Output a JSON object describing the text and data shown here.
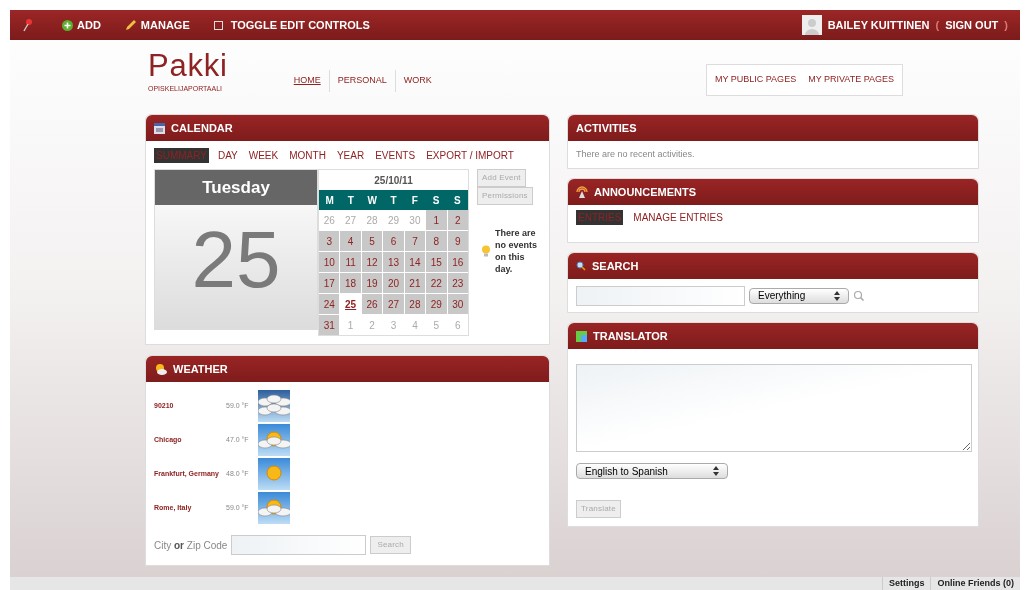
{
  "topbar": {
    "items": [
      {
        "label": "ADD"
      },
      {
        "label": "MANAGE"
      },
      {
        "label": "TOGGLE EDIT CONTROLS",
        "checked": false
      }
    ],
    "user": "BAILEY KUITTINEN",
    "paren_open": "(",
    "sign_out": "SIGN OUT",
    "paren_close": ")"
  },
  "site": {
    "logo": "Pakki",
    "tagline": "OPISKELIJAPORTAALI",
    "nav": [
      {
        "label": "HOME",
        "selected": true
      },
      {
        "label": "PERSONAL",
        "selected": false
      },
      {
        "label": "WORK",
        "selected": false
      }
    ],
    "page_links": [
      "MY PUBLIC PAGES",
      "MY PRIVATE PAGES"
    ]
  },
  "calendar": {
    "title": "CALENDAR",
    "tabs": [
      {
        "label": "SUMMARY",
        "selected": true
      },
      {
        "label": "DAY",
        "selected": false
      },
      {
        "label": "WEEK",
        "selected": false
      },
      {
        "label": "MONTH",
        "selected": false
      },
      {
        "label": "YEAR",
        "selected": false
      },
      {
        "label": "EVENTS",
        "selected": false
      },
      {
        "label": "EXPORT / IMPORT",
        "selected": false
      }
    ],
    "weekday": "Tuesday",
    "day": "25",
    "month_label": "25/10/11",
    "headers": [
      "M",
      "T",
      "W",
      "T",
      "F",
      "S",
      "S"
    ],
    "days": [
      {
        "n": "26",
        "kind": "other"
      },
      {
        "n": "27",
        "kind": "other"
      },
      {
        "n": "28",
        "kind": "other"
      },
      {
        "n": "29",
        "kind": "other"
      },
      {
        "n": "30",
        "kind": "other"
      },
      {
        "n": "1",
        "kind": "day"
      },
      {
        "n": "2",
        "kind": "day"
      },
      {
        "n": "3",
        "kind": "day"
      },
      {
        "n": "4",
        "kind": "day"
      },
      {
        "n": "5",
        "kind": "day"
      },
      {
        "n": "6",
        "kind": "day"
      },
      {
        "n": "7",
        "kind": "day"
      },
      {
        "n": "8",
        "kind": "day"
      },
      {
        "n": "9",
        "kind": "day"
      },
      {
        "n": "10",
        "kind": "day"
      },
      {
        "n": "11",
        "kind": "day"
      },
      {
        "n": "12",
        "kind": "day"
      },
      {
        "n": "13",
        "kind": "day"
      },
      {
        "n": "14",
        "kind": "day"
      },
      {
        "n": "15",
        "kind": "day"
      },
      {
        "n": "16",
        "kind": "day"
      },
      {
        "n": "17",
        "kind": "day"
      },
      {
        "n": "18",
        "kind": "day"
      },
      {
        "n": "19",
        "kind": "day"
      },
      {
        "n": "20",
        "kind": "day"
      },
      {
        "n": "21",
        "kind": "day"
      },
      {
        "n": "22",
        "kind": "day"
      },
      {
        "n": "23",
        "kind": "day"
      },
      {
        "n": "24",
        "kind": "day"
      },
      {
        "n": "25",
        "kind": "today"
      },
      {
        "n": "26",
        "kind": "day"
      },
      {
        "n": "27",
        "kind": "day"
      },
      {
        "n": "28",
        "kind": "day"
      },
      {
        "n": "29",
        "kind": "day"
      },
      {
        "n": "30",
        "kind": "day"
      },
      {
        "n": "31",
        "kind": "day"
      },
      {
        "n": "1",
        "kind": "other"
      },
      {
        "n": "2",
        "kind": "other"
      },
      {
        "n": "3",
        "kind": "other"
      },
      {
        "n": "4",
        "kind": "other"
      },
      {
        "n": "5",
        "kind": "other"
      },
      {
        "n": "6",
        "kind": "other"
      }
    ],
    "buttons": [
      "Add Event",
      "Permissions"
    ],
    "no_events": "There are no events on this day."
  },
  "weather": {
    "title": "WEATHER",
    "rows": [
      {
        "place": "90210",
        "temp": "59.0 °F",
        "kind": "cloudy"
      },
      {
        "place": "Chicago",
        "temp": "47.0 °F",
        "kind": "partly"
      },
      {
        "place": "Frankfurt, Germany",
        "temp": "48.0 °F",
        "kind": "sunny"
      },
      {
        "place": "Rome, Italy",
        "temp": "59.0 °F",
        "kind": "partly"
      }
    ],
    "field_label_1": "City",
    "field_label_or": "or",
    "field_label_2": "Zip Code",
    "button": "Search"
  },
  "activities": {
    "title": "ACTIVITIES",
    "empty": "There are no recent activities."
  },
  "announcements": {
    "title": "ANNOUNCEMENTS",
    "tabs": [
      {
        "label": "ENTRIES",
        "selected": true
      },
      {
        "label": "MANAGE ENTRIES",
        "selected": false
      }
    ]
  },
  "search": {
    "title": "SEARCH",
    "scope": "Everything"
  },
  "translator": {
    "title": "TRANSLATOR",
    "direction": "English to Spanish",
    "button": "Translate"
  },
  "status_bar": [
    "Settings",
    "Online Friends (0)"
  ]
}
